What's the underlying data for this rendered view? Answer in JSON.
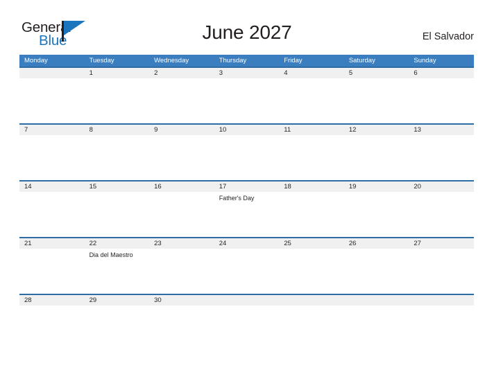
{
  "logo": {
    "word_top": "General",
    "word_bottom": "Blue",
    "flag_icon": "flag-triangle-icon",
    "brand_color": "#1b75bc"
  },
  "header": {
    "title": "June 2027",
    "country": "El Salvador"
  },
  "theme": {
    "header_blue": "#3a7ebf",
    "rule_blue": "#2e6da4",
    "band_gray": "#f0f0f0",
    "text_dark": "#231f20"
  },
  "calendar": {
    "month": "June",
    "year": "2027",
    "weekday_headers": [
      "Monday",
      "Tuesday",
      "Wednesday",
      "Thursday",
      "Friday",
      "Saturday",
      "Sunday"
    ],
    "weeks": [
      [
        {
          "date": "",
          "events": []
        },
        {
          "date": "1",
          "events": []
        },
        {
          "date": "2",
          "events": []
        },
        {
          "date": "3",
          "events": []
        },
        {
          "date": "4",
          "events": []
        },
        {
          "date": "5",
          "events": []
        },
        {
          "date": "6",
          "events": []
        }
      ],
      [
        {
          "date": "7",
          "events": []
        },
        {
          "date": "8",
          "events": []
        },
        {
          "date": "9",
          "events": []
        },
        {
          "date": "10",
          "events": []
        },
        {
          "date": "11",
          "events": []
        },
        {
          "date": "12",
          "events": []
        },
        {
          "date": "13",
          "events": []
        }
      ],
      [
        {
          "date": "14",
          "events": []
        },
        {
          "date": "15",
          "events": []
        },
        {
          "date": "16",
          "events": []
        },
        {
          "date": "17",
          "events": [
            "Father's Day"
          ]
        },
        {
          "date": "18",
          "events": []
        },
        {
          "date": "19",
          "events": []
        },
        {
          "date": "20",
          "events": []
        }
      ],
      [
        {
          "date": "21",
          "events": []
        },
        {
          "date": "22",
          "events": [
            "Dia del Maestro"
          ]
        },
        {
          "date": "23",
          "events": []
        },
        {
          "date": "24",
          "events": []
        },
        {
          "date": "25",
          "events": []
        },
        {
          "date": "26",
          "events": []
        },
        {
          "date": "27",
          "events": []
        }
      ],
      [
        {
          "date": "28",
          "events": []
        },
        {
          "date": "29",
          "events": []
        },
        {
          "date": "30",
          "events": []
        },
        {
          "date": "",
          "events": []
        },
        {
          "date": "",
          "events": []
        },
        {
          "date": "",
          "events": []
        },
        {
          "date": "",
          "events": []
        }
      ]
    ]
  }
}
